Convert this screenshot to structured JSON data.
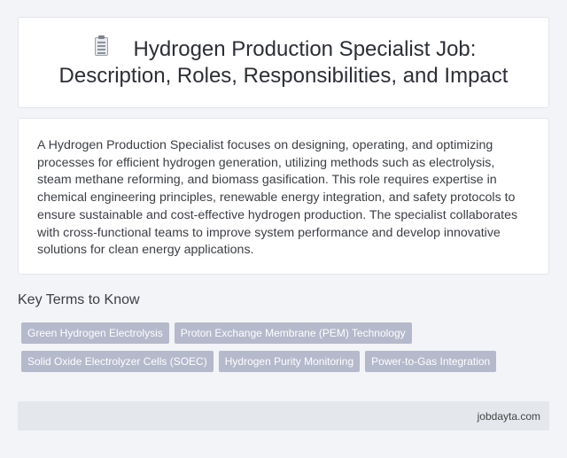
{
  "header": {
    "icon": "document-icon",
    "title": "Hydrogen Production Specialist Job: Description, Roles, Responsibilities, and Impact"
  },
  "description": "A Hydrogen Production Specialist focuses on designing, operating, and optimizing processes for efficient hydrogen generation, utilizing methods such as electrolysis, steam methane reforming, and biomass gasification. This role requires expertise in chemical engineering principles, renewable energy integration, and safety protocols to ensure sustainable and cost-effective hydrogen production. The specialist collaborates with cross-functional teams to improve system performance and develop innovative solutions for clean energy applications.",
  "key_terms": {
    "heading": "Key Terms to Know",
    "tags": [
      "Green Hydrogen Electrolysis",
      "Proton Exchange Membrane (PEM) Technology",
      "Solid Oxide Electrolyzer Cells (SOEC)",
      "Hydrogen Purity Monitoring",
      "Power-to-Gas Integration"
    ]
  },
  "footer": {
    "site": "jobdayta.com"
  },
  "colors": {
    "background": "#f3f4f7",
    "card": "#ffffff",
    "tag": "#b4b9cb",
    "footer": "#e4e8ed"
  }
}
